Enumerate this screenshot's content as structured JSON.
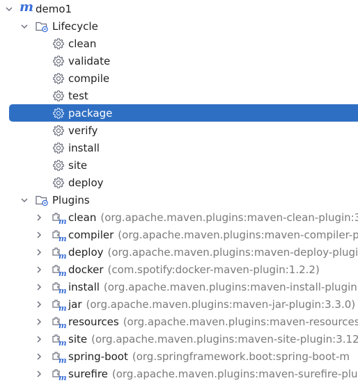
{
  "root": {
    "icon": "maven-icon",
    "icon_glyph": "m",
    "label": "demo1",
    "accent": "#3a6fd8"
  },
  "lifecycle": {
    "label": "Lifecycle",
    "icon": "folder-gear-icon",
    "items": [
      {
        "label": "clean"
      },
      {
        "label": "validate"
      },
      {
        "label": "compile"
      },
      {
        "label": "test"
      },
      {
        "label": "package",
        "selected": true
      },
      {
        "label": "verify"
      },
      {
        "label": "install"
      },
      {
        "label": "site"
      },
      {
        "label": "deploy"
      }
    ],
    "item_icon": "gear-icon"
  },
  "plugins": {
    "label": "Plugins",
    "icon": "folder-gear-icon",
    "item_icon": "maven-plugin-icon",
    "items": [
      {
        "name": "clean",
        "detail": "(org.apache.maven.plugins:maven-clean-plugin:3"
      },
      {
        "name": "compiler",
        "detail": "(org.apache.maven.plugins:maven-compiler-p"
      },
      {
        "name": "deploy",
        "detail": "(org.apache.maven.plugins:maven-deploy-plugi"
      },
      {
        "name": "docker",
        "detail": "(com.spotify:docker-maven-plugin:1.2.2)"
      },
      {
        "name": "install",
        "detail": "(org.apache.maven.plugins:maven-install-plugin:"
      },
      {
        "name": "jar",
        "detail": "(org.apache.maven.plugins:maven-jar-plugin:3.3.0)"
      },
      {
        "name": "resources",
        "detail": "(org.apache.maven.plugins:maven-resources"
      },
      {
        "name": "site",
        "detail": "(org.apache.maven.plugins:maven-site-plugin:3.12."
      },
      {
        "name": "spring-boot",
        "detail": "(org.springframework.boot:spring-boot-m"
      },
      {
        "name": "surefire",
        "detail": "(org.apache.maven.plugins:maven-surefire-plug"
      }
    ]
  },
  "colors": {
    "selection": "#2f6fc3",
    "detail_text": "#7a7a7a",
    "icon_stroke": "#6c707e",
    "maven_blue": "#3a6fd8"
  }
}
